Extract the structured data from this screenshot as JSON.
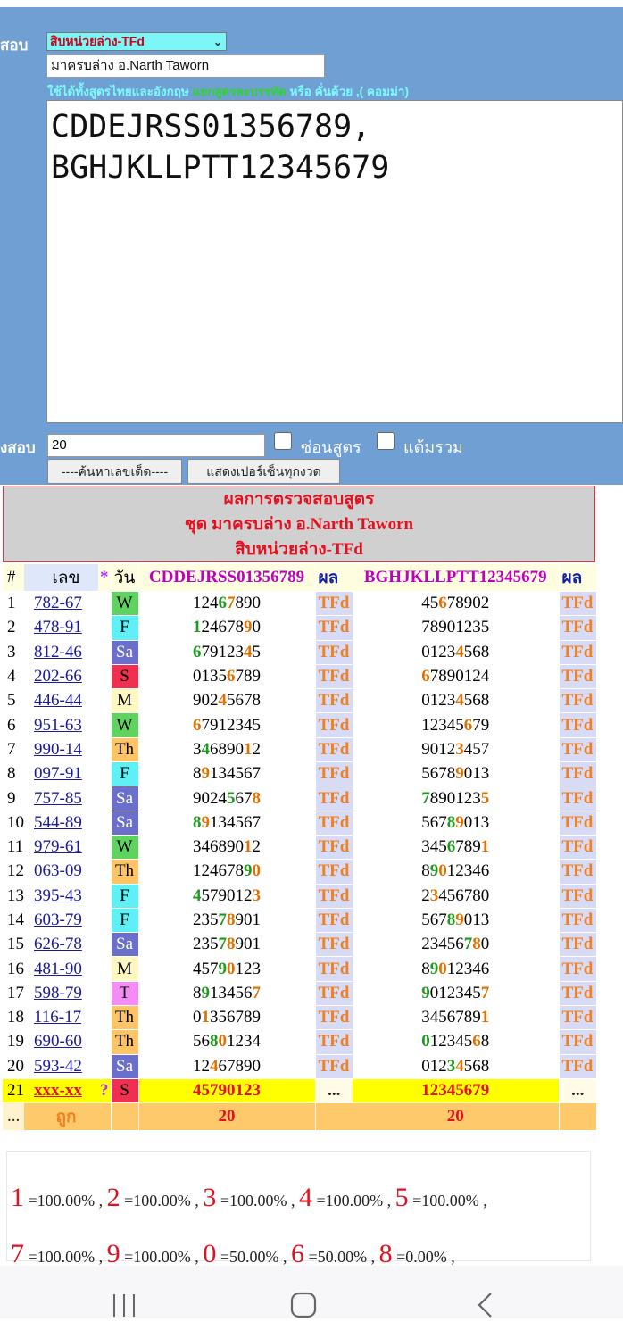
{
  "header": {
    "label_top": "สอบ",
    "select_value": "สิบหน่วยล่าง-TFd",
    "name_value": "มาครบล่าง อ.Narth Taworn",
    "hint_part1": "ใช้ได้ทั้งสูตรไทยและอังกฤษ ",
    "hint_part2": "แยกสูตรละบรรทัด",
    "hint_part3": " หรือ คั่นด้วย ,( คอมม่า)",
    "formula_text": "CDDEJRSS01356789,\nBGHJKLLPTT12345679",
    "label_count": "งสอบ",
    "count_value": "20",
    "hide_formula_label": "ซ่อนสูตร",
    "sum_score_label": "แต้มรวม",
    "btn_find": "----ค้นหาเลขเด็ด----",
    "btn_show_pct": "แสดงเปอร์เซ็นทุกงวด"
  },
  "result_box": {
    "line1": "ผลการตรวจสอบสูตร",
    "line2": "ชุด มาครบล่าง อ.Narth Taworn",
    "line3": "สิบหน่วยล่าง-TFd"
  },
  "table": {
    "headers": {
      "idx": "#",
      "num": "เลข",
      "star": "*",
      "day": "วัน",
      "f1": "CDDEJRSS01356789",
      "r1": "ผล",
      "f2": "BGHJKLLPTT12345679",
      "r2": "ผล"
    },
    "day_colors": {
      "W": "#5fd35f",
      "F": "#5ff0f5",
      "Sa": "#6b6fcc",
      "S": "#f03050",
      "M": "#fff7c0",
      "Th": "#ffc466",
      "T": "#f58cf5"
    },
    "rows": [
      {
        "i": "1",
        "num": "782-67",
        "day": "W",
        "d1": "12467890",
        "h1": [
          3,
          4
        ],
        "r1": "TFd",
        "d2": "45678902",
        "h2": [
          2
        ],
        "r2": "TFd"
      },
      {
        "i": "2",
        "num": "478-91",
        "day": "F",
        "d1": "12467890",
        "h1": [
          0,
          6
        ],
        "r1": "TFd",
        "d2": "78901235",
        "h2": [],
        "r2": "TFd"
      },
      {
        "i": "3",
        "num": "812-46",
        "day": "Sa",
        "d1": "67912345",
        "h1": [
          0,
          6
        ],
        "r1": "TFd",
        "d2": "01234568",
        "h2": [
          4
        ],
        "r2": "TFd"
      },
      {
        "i": "4",
        "num": "202-66",
        "day": "S",
        "d1": "01356789",
        "h1": [
          4
        ],
        "r1": "TFd",
        "d2": "67890124",
        "h2": [
          0
        ],
        "r2": "TFd"
      },
      {
        "i": "5",
        "num": "446-44",
        "day": "M",
        "d1": "90245678",
        "h1": [
          3
        ],
        "r1": "TFd",
        "d2": "01234568",
        "h2": [
          4
        ],
        "r2": "TFd"
      },
      {
        "i": "6",
        "num": "951-63",
        "day": "W",
        "d1": "67912345",
        "h1": [
          0
        ],
        "r1": "TFd",
        "d2": "12345679",
        "h2": [
          5
        ],
        "r2": "TFd"
      },
      {
        "i": "7",
        "num": "990-14",
        "day": "Th",
        "d1": "34689012",
        "h1": [
          1,
          6
        ],
        "r1": "TFd",
        "d2": "90123457",
        "h2": [
          4
        ],
        "r2": "TFd"
      },
      {
        "i": "8",
        "num": "097-91",
        "day": "F",
        "d1": "89134567",
        "h1": [
          1
        ],
        "r1": "TFd",
        "d2": "56789013",
        "h2": [
          4
        ],
        "r2": "TFd"
      },
      {
        "i": "9",
        "num": "757-85",
        "day": "Sa",
        "d1": "90245678",
        "h1": [
          4,
          7
        ],
        "r1": "TFd",
        "d2": "78901235",
        "h2": [
          0,
          7
        ],
        "r2": "TFd"
      },
      {
        "i": "10",
        "num": "544-89",
        "day": "Sa",
        "d1": "89134567",
        "h1": [
          0,
          1
        ],
        "r1": "TFd",
        "d2": "56789013",
        "h2": [
          3,
          4
        ],
        "r2": "TFd"
      },
      {
        "i": "11",
        "num": "979-61",
        "day": "W",
        "d1": "34689012",
        "h1": [
          6
        ],
        "r1": "TFd",
        "d2": "34567891",
        "h2": [
          3,
          7
        ],
        "r2": "TFd"
      },
      {
        "i": "12",
        "num": "063-09",
        "day": "Th",
        "d1": "12467890",
        "h1": [
          6,
          7
        ],
        "r1": "TFd",
        "d2": "89012346",
        "h2": [
          1,
          2
        ],
        "r2": "TFd"
      },
      {
        "i": "13",
        "num": "395-43",
        "day": "F",
        "d1": "45790123",
        "h1": [
          0,
          7
        ],
        "r1": "TFd",
        "d2": "23456780",
        "h2": [
          1
        ],
        "r2": "TFd"
      },
      {
        "i": "14",
        "num": "603-79",
        "day": "F",
        "d1": "23578901",
        "h1": [
          3,
          4
        ],
        "r1": "TFd",
        "d2": "56789013",
        "h2": [
          3,
          4
        ],
        "r2": "TFd"
      },
      {
        "i": "15",
        "num": "626-78",
        "day": "Sa",
        "d1": "23578901",
        "h1": [
          3,
          4
        ],
        "r1": "TFd",
        "d2": "23456780",
        "h2": [
          5,
          6
        ],
        "r2": "TFd"
      },
      {
        "i": "16",
        "num": "481-90",
        "day": "M",
        "d1": "45790123",
        "h1": [
          3,
          4
        ],
        "r1": "TFd",
        "d2": "89012346",
        "h2": [
          1,
          2
        ],
        "r2": "TFd"
      },
      {
        "i": "17",
        "num": "598-79",
        "day": "T",
        "d1": "89134567",
        "h1": [
          1,
          7
        ],
        "r1": "TFd",
        "d2": "90123457",
        "h2": [
          0,
          7
        ],
        "r2": "TFd"
      },
      {
        "i": "18",
        "num": "116-17",
        "day": "Th",
        "d1": "01356789",
        "h1": [
          1
        ],
        "r1": "TFd",
        "d2": "34567891",
        "h2": [
          7
        ],
        "r2": "TFd"
      },
      {
        "i": "19",
        "num": "690-60",
        "day": "Th",
        "d1": "56801234",
        "h1": [
          2,
          3
        ],
        "r1": "TFd",
        "d2": "01234568",
        "h2": [
          0,
          6
        ],
        "r2": "TFd"
      },
      {
        "i": "20",
        "num": "593-42",
        "day": "Sa",
        "d1": "12467890",
        "h1": [
          2
        ],
        "r1": "TFd",
        "d2": "01234568",
        "h2": [
          3,
          4
        ],
        "r2": "TFd"
      }
    ],
    "last_row": {
      "i": "21",
      "num": "xxx-xx",
      "star": "?",
      "day": "S",
      "d1": "45790123",
      "r1": "...",
      "d2": "12345679",
      "r2": "..."
    },
    "total_row": {
      "i": "...",
      "label": "ถูก",
      "t1": "20",
      "t2": "20"
    }
  },
  "percentages": [
    {
      "d": "1",
      "p": " =100.00% , "
    },
    {
      "d": "2",
      "p": " =100.00% , "
    },
    {
      "d": "3",
      "p": " =100.00% , "
    },
    {
      "d": "4",
      "p": " =100.00% , "
    },
    {
      "d": "5",
      "p": " =100.00% ,"
    },
    {
      "d": "7",
      "p": " =100.00% , "
    },
    {
      "d": "9",
      "p": " =100.00% , "
    },
    {
      "d": "0",
      "p": " =50.00% , "
    },
    {
      "d": "6",
      "p": " =50.00% , "
    },
    {
      "d": "8",
      "p": " =0.00% ,"
    }
  ]
}
